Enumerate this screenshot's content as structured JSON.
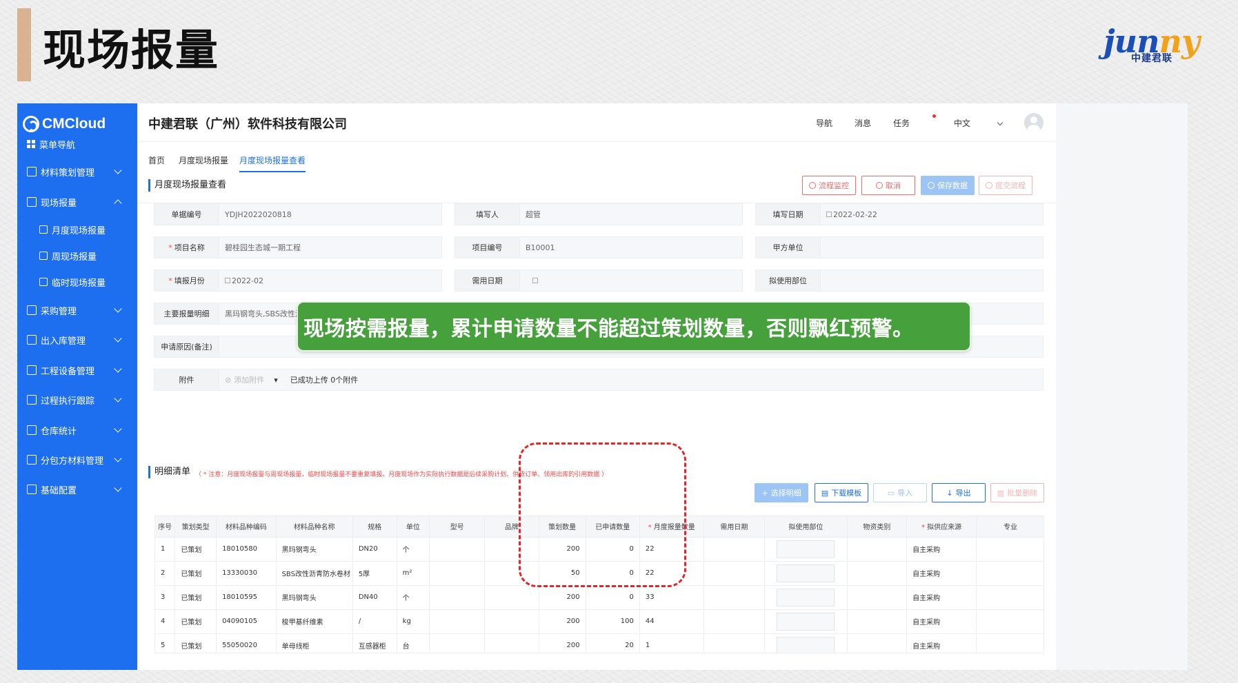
{
  "slide": {
    "title": "现场报量",
    "brand_word_1": "jun",
    "brand_word_2": "ny",
    "brand_sub": "中建君联"
  },
  "sidebar": {
    "logo": "CMCloud",
    "items": [
      {
        "label": "菜单导航"
      },
      {
        "label": "材料策划管理"
      },
      {
        "label": "现场报量"
      },
      {
        "label": "月度现场报量"
      },
      {
        "label": "周现场报量"
      },
      {
        "label": "临时现场报量"
      },
      {
        "label": "采购管理"
      },
      {
        "label": "出入库管理"
      },
      {
        "label": "工程设备管理"
      },
      {
        "label": "过程执行跟踪"
      },
      {
        "label": "仓库统计"
      },
      {
        "label": "分包方材料管理"
      },
      {
        "label": "基础配置"
      }
    ]
  },
  "header": {
    "company": "中建君联（广州）软件科技有限公司",
    "nav": "导航",
    "messages": "消息",
    "tasks": "任务",
    "lang": "中文"
  },
  "tabs": [
    "首页",
    "月度现场报量",
    "月度现场报量查看"
  ],
  "page": {
    "title": "月度现场报量查看",
    "buttons": {
      "monitor": "流程监控",
      "cancel": "取消",
      "save": "保存数据",
      "submit": "提交流程"
    }
  },
  "form": {
    "doc_no_label": "单据编号",
    "doc_no": "YDJH2022020818",
    "filler_label": "填写人",
    "filler": "超管",
    "fill_date_label": "填写日期",
    "fill_date": "2022-02-22",
    "project_name_label": "项目名称",
    "project_name": "碧桂园生态城一期工程",
    "project_no_label": "项目编号",
    "project_no": "B10001",
    "party_a_label": "甲方单位",
    "party_a": "",
    "month_label": "填报月份",
    "month": "2022-02",
    "need_date_label": "需用日期",
    "need_date": "",
    "use_dept_label": "拟使用部位",
    "use_dept": "",
    "main_detail_label": "主要报量明细",
    "main_detail": "黑玛钢弯头,SBS改性沥青防水",
    "reason_label": "申请原因(备注)",
    "reason": "",
    "attachment_label": "附件",
    "attachment_add": "添加附件",
    "attachment_status": "已成功上传 0个附件"
  },
  "callout": "现场按需报量，累计申请数量不能超过策划数量，否则飘红预警。",
  "detail": {
    "title": "明细清单",
    "note": "（ * 注意：月度现场报量与周现场报量，临时现场报量不要重复填报。月度现场作为实际执行数据是后续采购计划、供货订单、领用出库的引用数据 ）",
    "buttons": {
      "select": "选择明细",
      "template": "下载模板",
      "import": "导入",
      "export": "导出",
      "batch_delete": "批量删除"
    },
    "columns": [
      "序号",
      "策划类型",
      "材料品种编码",
      "材料品种名称",
      "规格",
      "单位",
      "型号",
      "品牌",
      "策划数量",
      "已申请数量",
      "月度报量数量",
      "需用日期",
      "拟使用部位",
      "物资类别",
      "拟供应来源",
      "专业"
    ],
    "rows": [
      {
        "no": "1",
        "type": "已策划",
        "code": "18010580",
        "name": "黑玛钢弯头",
        "spec": "DN20",
        "unit": "个",
        "model": "",
        "brand": "",
        "plan": "200",
        "applied": "0",
        "monthly": "22",
        "date": "",
        "category": "",
        "source": "自主采购",
        "major": ""
      },
      {
        "no": "2",
        "type": "已策划",
        "code": "13330030",
        "name": "SBS改性沥青防水卷材",
        "spec": "5厚",
        "unit": "m²",
        "model": "",
        "brand": "",
        "plan": "50",
        "applied": "0",
        "monthly": "22",
        "date": "",
        "category": "",
        "source": "自主采购",
        "major": ""
      },
      {
        "no": "3",
        "type": "已策划",
        "code": "18010595",
        "name": "黑玛钢弯头",
        "spec": "DN40",
        "unit": "个",
        "model": "",
        "brand": "",
        "plan": "200",
        "applied": "0",
        "monthly": "33",
        "date": "",
        "category": "",
        "source": "自主采购",
        "major": ""
      },
      {
        "no": "4",
        "type": "已策划",
        "code": "04090105",
        "name": "梭甲基纤维素",
        "spec": "/",
        "unit": "kg",
        "model": "",
        "brand": "",
        "plan": "200",
        "applied": "100",
        "monthly": "44",
        "date": "",
        "category": "",
        "source": "自主采购",
        "major": ""
      },
      {
        "no": "5",
        "type": "已策划",
        "code": "55050020",
        "name": "单母线柜",
        "spec": "互感器柜",
        "unit": "台",
        "model": "",
        "brand": "",
        "plan": "200",
        "applied": "20",
        "monthly": "1",
        "date": "",
        "category": "",
        "source": "自主采购",
        "major": ""
      }
    ]
  },
  "colors": {
    "sidebar": "#1e6ff0",
    "slide_accent": "#d9b391",
    "callout": "#46a13d",
    "warning": "#e0282b"
  }
}
